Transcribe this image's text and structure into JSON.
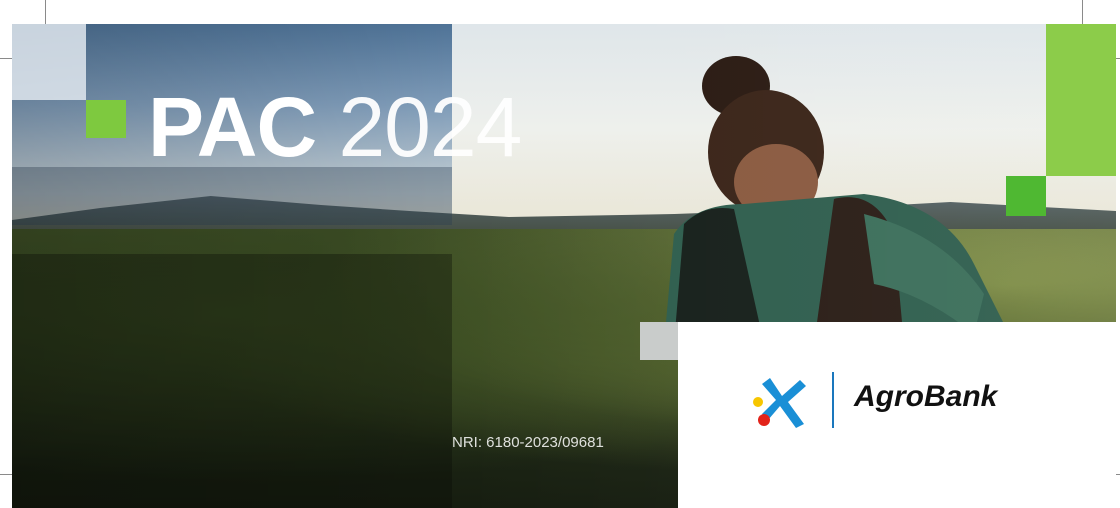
{
  "banner": {
    "title_bold": "PAC",
    "title_light": "2024",
    "nri": "NRI: 6180-2023/09681"
  },
  "logo": {
    "brand_name": "AgroBank",
    "mark": "caixabank-star-icon"
  },
  "colors": {
    "green_light": "#8ccc4a",
    "green_mid": "#7ec93f",
    "green_dark": "#4fb832",
    "logo_blue": "#1a77bd",
    "logo_red": "#e2231a",
    "logo_yellow": "#f7c600"
  }
}
